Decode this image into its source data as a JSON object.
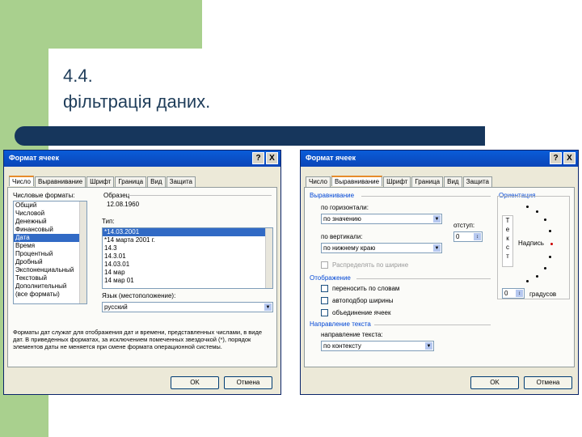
{
  "slide": {
    "title_line1": "4.4.",
    "title_line2": "фільтрація даних."
  },
  "dialog_left": {
    "title": "Формат ячеек",
    "help": "?",
    "close": "X",
    "tabs": [
      "Число",
      "Выравнивание",
      "Шрифт",
      "Граница",
      "Вид",
      "Защита"
    ],
    "formats_label": "Числовые форматы:",
    "formats": [
      "Общий",
      "Числовой",
      "Денежный",
      "Финансовый",
      "Дата",
      "Время",
      "Процентный",
      "Дробный",
      "Экспоненциальный",
      "Текстовый",
      "Дополнительный",
      "(все форматы)"
    ],
    "sample_label": "Образец",
    "sample_value": "12.08.1960",
    "type_label": "Тип:",
    "types": [
      "*14.03.2001",
      "*14 марта 2001 г.",
      "14.3",
      "14.3.01",
      "14.03.01",
      "14 мар",
      "14 мар 01"
    ],
    "locale_label": "Язык (местоположение):",
    "locale_value": "русский",
    "description": "Форматы дат служат для отображения дат и времени, представленных числами, в виде дат. В приведенных форматах, за исключением помеченных звездочкой (*), порядок элементов даты не меняется при смене формата операционной системы.",
    "ok": "OK",
    "cancel": "Отмена"
  },
  "dialog_right": {
    "title": "Формат ячеек",
    "help": "?",
    "close": "X",
    "tabs": [
      "Число",
      "Выравнивание",
      "Шрифт",
      "Граница",
      "Вид",
      "Защита"
    ],
    "align_group": "Выравнивание",
    "horiz_label": "по горизонтали:",
    "horiz_value": "по значению",
    "indent_label": "отступ:",
    "indent_value": "0",
    "vert_label": "по вертикали:",
    "vert_value": "по нижнему краю",
    "distribute_label": "Распределять по ширине",
    "display_group": "Отображение",
    "wrap_label": "переносить по словам",
    "autofit_label": "автоподбор ширины",
    "merge_label": "объединение ячеек",
    "direction_group": "Направление текста",
    "direction_label": "направление текста:",
    "direction_value": "по контексту",
    "orientation_group": "Ориентация",
    "vertical_text": [
      "Т",
      "е",
      "к",
      "с",
      "т"
    ],
    "orientation_caption": "Надпись",
    "degrees_value": "0",
    "degrees_label": "градусов",
    "ok": "OK",
    "cancel": "Отмена"
  }
}
